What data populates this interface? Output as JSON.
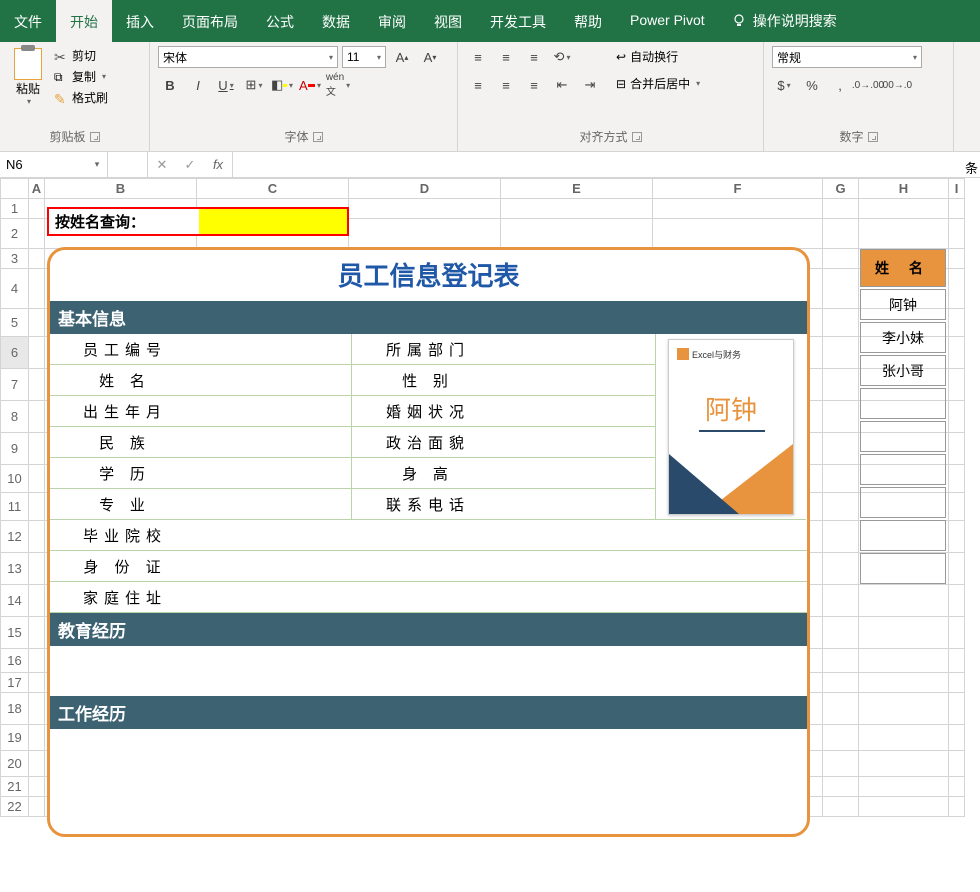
{
  "tabs": [
    "文件",
    "开始",
    "插入",
    "页面布局",
    "公式",
    "数据",
    "审阅",
    "视图",
    "开发工具",
    "帮助",
    "Power Pivot"
  ],
  "active_tab": 1,
  "tell_me": "操作说明搜索",
  "ribbon": {
    "clipboard": {
      "label": "剪贴板",
      "paste": "粘贴",
      "cut": "剪切",
      "copy": "复制",
      "format_painter": "格式刷"
    },
    "font": {
      "label": "字体",
      "name": "宋体",
      "size": "11"
    },
    "alignment": {
      "label": "对齐方式",
      "wrap": "自动换行",
      "merge": "合并后居中"
    },
    "number": {
      "label": "数字",
      "format": "常规"
    },
    "cond": "条"
  },
  "name_box": "N6",
  "formula": "",
  "columns": [
    "A",
    "B",
    "C",
    "D",
    "E",
    "F",
    "G",
    "H",
    "I"
  ],
  "rows": [
    "1",
    "2",
    "3",
    "4",
    "5",
    "6",
    "7",
    "8",
    "9",
    "10",
    "11",
    "12",
    "13",
    "14",
    "15",
    "16",
    "17",
    "18",
    "19",
    "20",
    "21",
    "22"
  ],
  "query_label": "按姓名查询：",
  "form": {
    "title": "员工信息登记表",
    "sec_basic": "基本信息",
    "sec_edu": "教育经历",
    "sec_work": "工作经历",
    "labels": {
      "emp_no": "员工编号",
      "dept": "所属部门",
      "name": "姓  名",
      "gender": "性  别",
      "birth": "出生年月",
      "marital": "婚姻状况",
      "ethnic": "民  族",
      "political": "政治面貌",
      "edu": "学  历",
      "height": "身  高",
      "major": "专  业",
      "phone": "联系电话",
      "school": "毕业院校",
      "id": "身 份 证",
      "addr": "家庭住址"
    },
    "photo": {
      "brand": "Excel与财务",
      "name": "阿钟"
    }
  },
  "name_list": {
    "header": "姓 名",
    "items": [
      "阿钟",
      "李小妹",
      "张小哥",
      "",
      "",
      "",
      "",
      "",
      ""
    ]
  }
}
